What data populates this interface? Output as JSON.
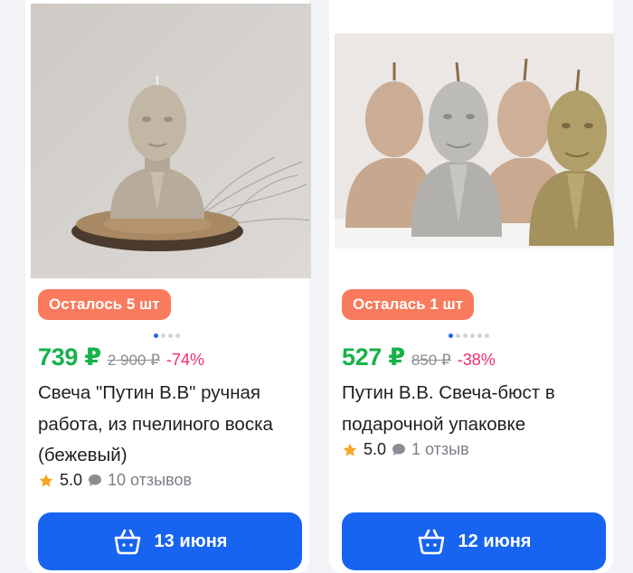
{
  "colors": {
    "price": "#16b24a",
    "discount": "#ef2b70",
    "stock_badge": "#f97a5d",
    "button": "#1764f0",
    "star": "#f5a623"
  },
  "products": [
    {
      "stock_badge": "Осталось 5 шт",
      "price": "739 ₽",
      "old_price": "2 900 ₽",
      "discount": "-74%",
      "title": "Свеча \"Путин В.В\" ручная работа, из пчелиного воска (бежевый)",
      "rating": "5.0",
      "reviews": "10 отзывов",
      "button_label": "13 июня",
      "image_dots": 4,
      "active_dot": 0
    },
    {
      "stock_badge": "Осталась 1 шт",
      "price": "527 ₽",
      "old_price": "850 ₽",
      "discount": "-38%",
      "title": "Путин В.В. Свеча-бюст в подарочной упаковке",
      "rating": "5.0",
      "reviews": "1 отзыв",
      "button_label": "12 июня",
      "image_dots": 6,
      "active_dot": 0
    }
  ]
}
